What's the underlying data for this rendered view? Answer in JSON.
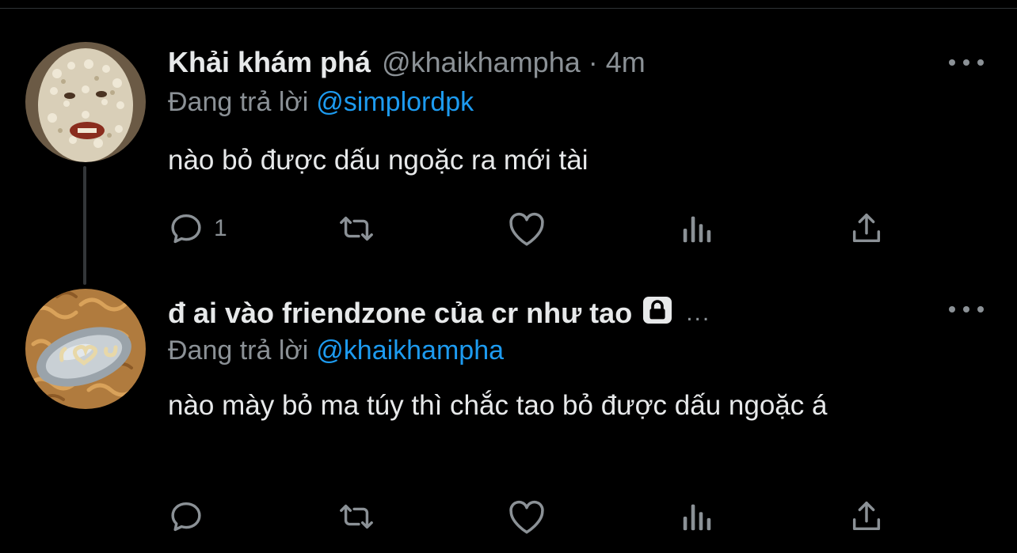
{
  "colors": {
    "background": "#000000",
    "text": "#e7e9ea",
    "muted": "#8b9196",
    "link": "#1d9bf0",
    "thread_line": "#333639"
  },
  "tweets": [
    {
      "display_name": "Khải khám phá",
      "handle": "@khaikhampha",
      "separator": "·",
      "time": "4m",
      "reply_prefix": "Đang trả lời",
      "reply_to": "@simplordpk",
      "text": "nào bỏ được dấu ngoặc ra mới tài",
      "reply_count": "1",
      "icons": [
        "reply-icon",
        "retweet-icon",
        "like-icon",
        "analytics-icon",
        "share-icon",
        "more-icon"
      ]
    },
    {
      "display_name": "đ ai vào friendzone của cr như tao",
      "name_trail": "...",
      "locked": true,
      "reply_prefix": "Đang trả lời",
      "reply_to": "@khaikhampha",
      "text": "nào mày bỏ ma túy thì chắc tao bỏ được dấu ngoặc á",
      "reply_count": "",
      "icons": [
        "lock-icon",
        "reply-icon",
        "retweet-icon",
        "like-icon",
        "analytics-icon",
        "share-icon",
        "more-icon"
      ]
    }
  ]
}
